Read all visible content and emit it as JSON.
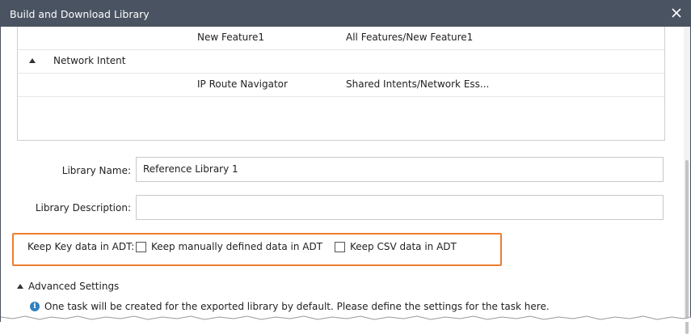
{
  "dialog": {
    "title": "Build and Download Library",
    "close_icon": "close-icon"
  },
  "tree": {
    "rows": [
      {
        "name": "New Feature1",
        "path": "All Features/New Feature1"
      },
      {
        "group": "Network Intent",
        "icon": "collapse-triangle-icon"
      },
      {
        "name": "IP Route Navigator",
        "path": "Shared Intents/Network Ess..."
      }
    ]
  },
  "form": {
    "library_name_label": "Library Name:",
    "library_name_value": "Reference Library 1",
    "library_description_label": "Library Description:",
    "library_description_value": "",
    "keep_key_label": "Keep Key data in ADT:",
    "keep_manual_label": "Keep manually defined data in ADT",
    "keep_manual_checked": false,
    "keep_csv_label": "Keep CSV data in ADT",
    "keep_csv_checked": false
  },
  "advanced": {
    "label": "Advanced Settings",
    "info_text": "One task will be created for the exported library by default. Please define the settings for the task here.",
    "info_icon": "info-icon"
  },
  "colors": {
    "titlebar": "#4a5361",
    "highlight": "#ee7d31",
    "info": "#2f7fc1"
  }
}
